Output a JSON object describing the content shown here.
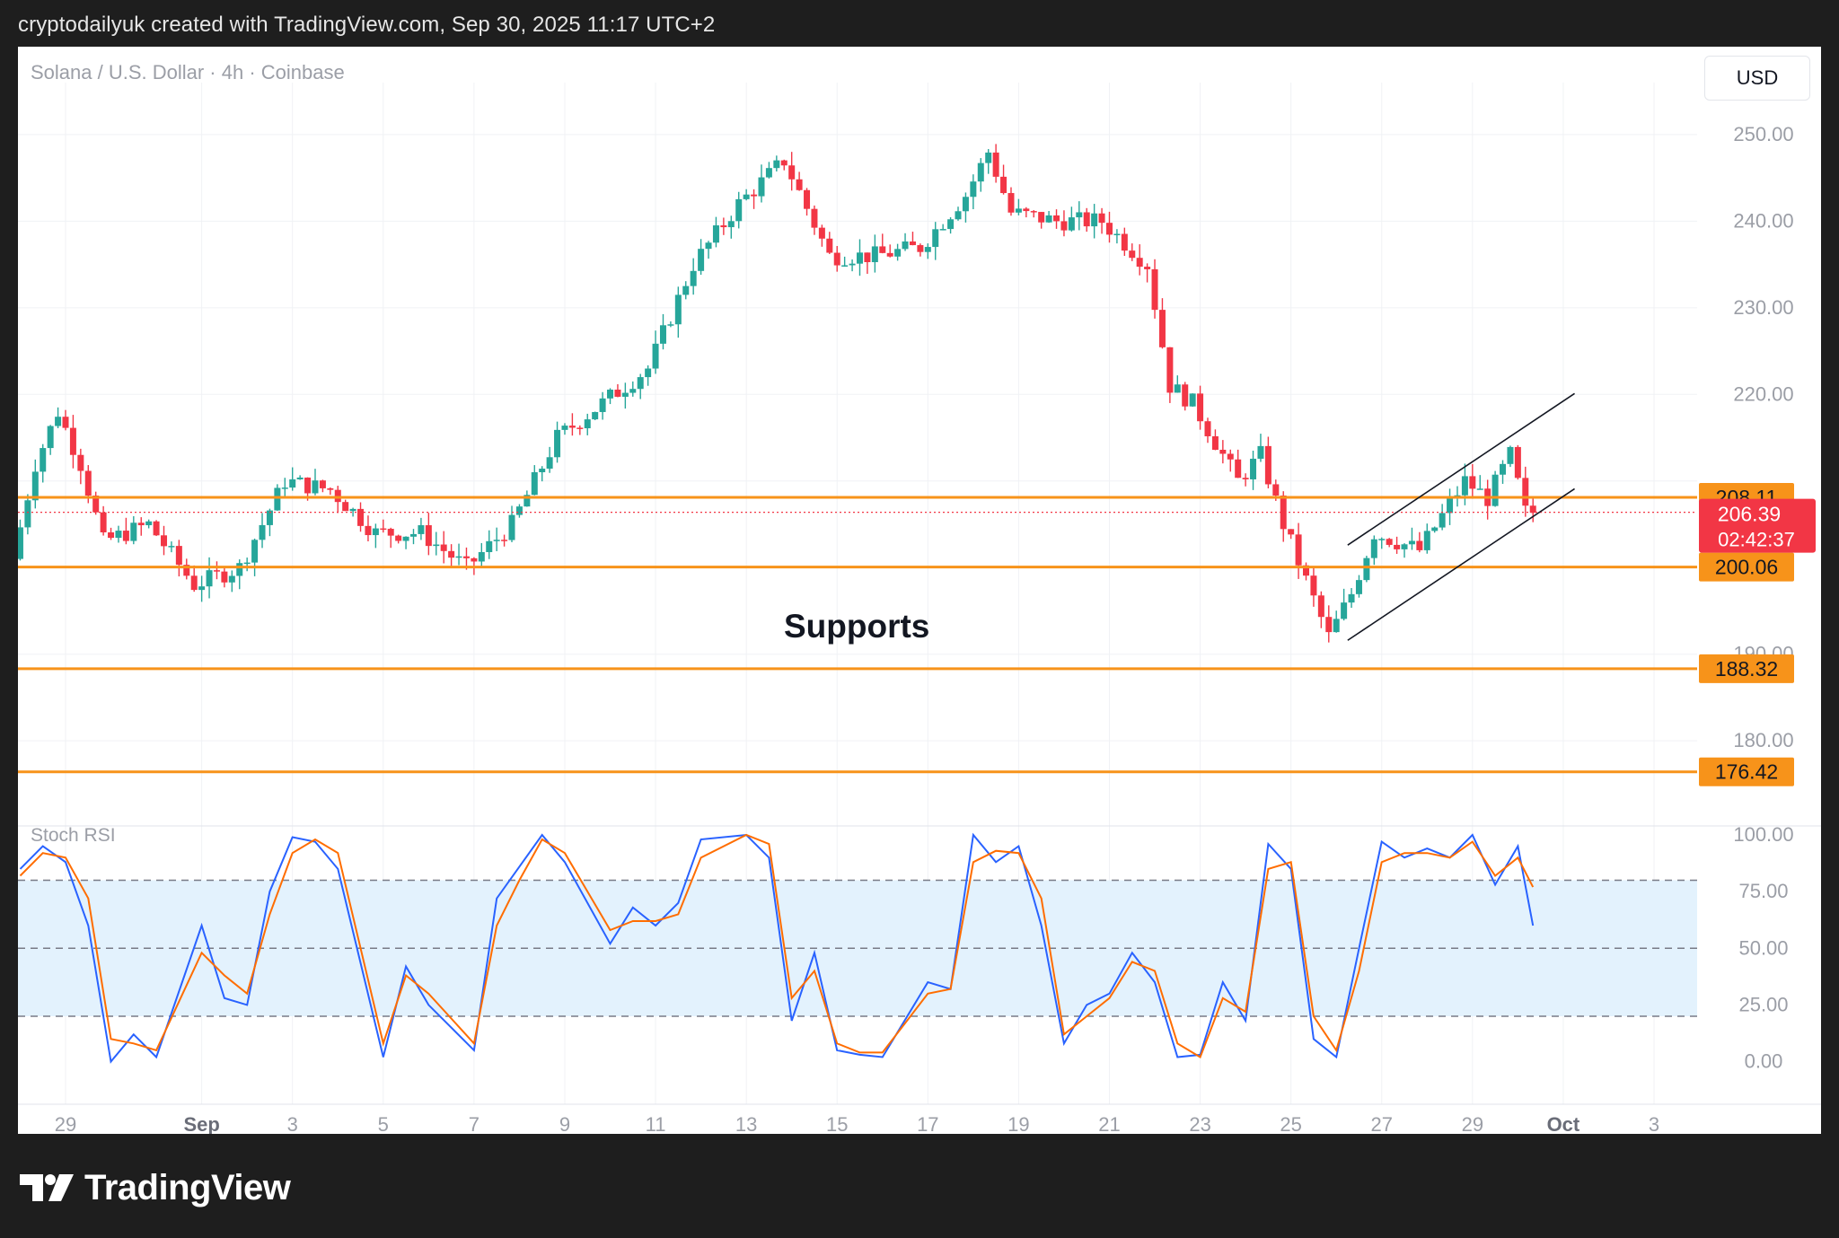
{
  "header": {
    "credit": "cryptodailyuk created with TradingView.com, Sep 30, 2025 11:17 UTC+2"
  },
  "footer": {
    "brand": "TradingView"
  },
  "chart_header": {
    "title": "Solana / U.S. Dollar · 4h · Coinbase",
    "currency_button": "USD"
  },
  "colors": {
    "bull": "#26a69a",
    "bear": "#f23645",
    "support_line": "#f7931a",
    "channel": "#131722",
    "stoch_k": "#2962ff",
    "stoch_d": "#ff6d00",
    "stoch_band": "#e3f2fd"
  },
  "chart_data": [
    {
      "type": "line",
      "title": "Solana / U.S. Dollar · 4h · Coinbase",
      "x_ticks": [
        "29",
        "Sep",
        "3",
        "5",
        "7",
        "9",
        "11",
        "13",
        "15",
        "17",
        "19",
        "21",
        "23",
        "25",
        "27",
        "29",
        "Oct",
        "3"
      ],
      "y_ticks": [
        "250.00",
        "240.00",
        "230.00",
        "220.00",
        "190.00",
        "180.00"
      ],
      "ylim": [
        171,
        256
      ],
      "grid": true,
      "price_path": [
        {
          "x": "Aug 28",
          "y": 201
        },
        {
          "x": "Aug 28 12:00",
          "y": 212
        },
        {
          "x": "Aug 29",
          "y": 218
        },
        {
          "x": "Aug 29 12:00",
          "y": 212
        },
        {
          "x": "Aug 30",
          "y": 203
        },
        {
          "x": "Aug 31",
          "y": 205
        },
        {
          "x": "Sep 1",
          "y": 198
        },
        {
          "x": "Sep 2",
          "y": 200
        },
        {
          "x": "Sep 3",
          "y": 210
        },
        {
          "x": "Sep 4",
          "y": 209
        },
        {
          "x": "Sep 5",
          "y": 204
        },
        {
          "x": "Sep 6",
          "y": 204
        },
        {
          "x": "Sep 7",
          "y": 200
        },
        {
          "x": "Sep 8",
          "y": 205
        },
        {
          "x": "Sep 9",
          "y": 215
        },
        {
          "x": "Sep 10",
          "y": 219
        },
        {
          "x": "Sep 11",
          "y": 223
        },
        {
          "x": "Sep 12",
          "y": 235
        },
        {
          "x": "Sep 13",
          "y": 242
        },
        {
          "x": "Sep 14",
          "y": 247
        },
        {
          "x": "Sep 15",
          "y": 236
        },
        {
          "x": "Sep 16",
          "y": 236
        },
        {
          "x": "Sep 17",
          "y": 237
        },
        {
          "x": "Sep 18",
          "y": 243
        },
        {
          "x": "Sep 18 12:00",
          "y": 248
        },
        {
          "x": "Sep 19",
          "y": 241
        },
        {
          "x": "Sep 20",
          "y": 240
        },
        {
          "x": "Sep 21",
          "y": 240
        },
        {
          "x": "Sep 22",
          "y": 235
        },
        {
          "x": "Sep 22 12:00",
          "y": 221
        },
        {
          "x": "Sep 23",
          "y": 219
        },
        {
          "x": "Sep 24",
          "y": 210
        },
        {
          "x": "Sep 24 12:00",
          "y": 213
        },
        {
          "x": "Sep 25",
          "y": 205
        },
        {
          "x": "Sep 26",
          "y": 192
        },
        {
          "x": "Sep 26 12:00",
          "y": 197
        },
        {
          "x": "Sep 27",
          "y": 204
        },
        {
          "x": "Sep 28",
          "y": 202
        },
        {
          "x": "Sep 29",
          "y": 210
        },
        {
          "x": "Sep 29 12:00",
          "y": 208
        },
        {
          "x": "Sep 30",
          "y": 213
        },
        {
          "x": "Sep 30 08:00",
          "y": 206.39
        }
      ],
      "support_levels": [
        "208.11",
        "200.06",
        "188.32",
        "176.42"
      ],
      "current_price": "206.39",
      "countdown": "02:42:37",
      "annotation": "Supports",
      "ascending_channel": {
        "upper": [
          {
            "x": "Sep 26 06:00",
            "y": 202.6
          },
          {
            "x": "Oct 1 06:00",
            "y": 220.1
          }
        ],
        "lower": [
          {
            "x": "Sep 26 06:00",
            "y": 191.6
          },
          {
            "x": "Oct 1 06:00",
            "y": 209.1
          }
        ]
      }
    },
    {
      "type": "line",
      "title": "Stoch RSI",
      "y_ticks": [
        "100.00",
        "75.00",
        "50.00",
        "25.00",
        "0.00"
      ],
      "ylim": [
        0,
        100
      ],
      "band": [
        20,
        80
      ],
      "series": [
        {
          "color": "#2962ff",
          "points": [
            {
              "x": "Aug 28",
              "y": 85
            },
            {
              "x": "Aug 28 12:00",
              "y": 95
            },
            {
              "x": "Aug 29",
              "y": 88
            },
            {
              "x": "Aug 29 12:00",
              "y": 60
            },
            {
              "x": "Aug 30",
              "y": 0
            },
            {
              "x": "Aug 30 12:00",
              "y": 12
            },
            {
              "x": "Aug 31",
              "y": 2
            },
            {
              "x": "Sep 1",
              "y": 60
            },
            {
              "x": "Sep 1 12:00",
              "y": 28
            },
            {
              "x": "Sep 2",
              "y": 25
            },
            {
              "x": "Sep 2 12:00",
              "y": 75
            },
            {
              "x": "Sep 3",
              "y": 99
            },
            {
              "x": "Sep 3 12:00",
              "y": 97
            },
            {
              "x": "Sep 4",
              "y": 85
            },
            {
              "x": "Sep 5",
              "y": 2
            },
            {
              "x": "Sep 5 12:00",
              "y": 42
            },
            {
              "x": "Sep 6",
              "y": 25
            },
            {
              "x": "Sep 7",
              "y": 5
            },
            {
              "x": "Sep 7 12:00",
              "y": 72
            },
            {
              "x": "Sep 8",
              "y": 86
            },
            {
              "x": "Sep 8 12:00",
              "y": 100
            },
            {
              "x": "Sep 9",
              "y": 88
            },
            {
              "x": "Sep 10",
              "y": 52
            },
            {
              "x": "Sep 10 12:00",
              "y": 68
            },
            {
              "x": "Sep 11",
              "y": 60
            },
            {
              "x": "Sep 11 12:00",
              "y": 70
            },
            {
              "x": "Sep 12",
              "y": 98
            },
            {
              "x": "Sep 13",
              "y": 100
            },
            {
              "x": "Sep 13 12:00",
              "y": 90
            },
            {
              "x": "Sep 14",
              "y": 18
            },
            {
              "x": "Sep 14 12:00",
              "y": 48
            },
            {
              "x": "Sep 15",
              "y": 5
            },
            {
              "x": "Sep 15 12:00",
              "y": 3
            },
            {
              "x": "Sep 16",
              "y": 2
            },
            {
              "x": "Sep 17",
              "y": 35
            },
            {
              "x": "Sep 17 12:00",
              "y": 32
            },
            {
              "x": "Sep 18",
              "y": 100
            },
            {
              "x": "Sep 18 12:00",
              "y": 88
            },
            {
              "x": "Sep 19",
              "y": 95
            },
            {
              "x": "Sep 19 12:00",
              "y": 60
            },
            {
              "x": "Sep 20",
              "y": 8
            },
            {
              "x": "Sep 20 12:00",
              "y": 25
            },
            {
              "x": "Sep 21",
              "y": 30
            },
            {
              "x": "Sep 21 12:00",
              "y": 48
            },
            {
              "x": "Sep 22",
              "y": 35
            },
            {
              "x": "Sep 22 12:00",
              "y": 2
            },
            {
              "x": "Sep 23",
              "y": 3
            },
            {
              "x": "Sep 23 12:00",
              "y": 35
            },
            {
              "x": "Sep 24",
              "y": 18
            },
            {
              "x": "Sep 24 12:00",
              "y": 96
            },
            {
              "x": "Sep 25",
              "y": 85
            },
            {
              "x": "Sep 25 12:00",
              "y": 10
            },
            {
              "x": "Sep 26",
              "y": 2
            },
            {
              "x": "Sep 26 12:00",
              "y": 50
            },
            {
              "x": "Sep 27",
              "y": 97
            },
            {
              "x": "Sep 27 12:00",
              "y": 90
            },
            {
              "x": "Sep 28",
              "y": 94
            },
            {
              "x": "Sep 28 12:00",
              "y": 90
            },
            {
              "x": "Sep 29",
              "y": 100
            },
            {
              "x": "Sep 29 12:00",
              "y": 78
            },
            {
              "x": "Sep 30",
              "y": 95
            },
            {
              "x": "Sep 30 08:00",
              "y": 60
            }
          ]
        },
        {
          "color": "#ff6d00",
          "points": [
            {
              "x": "Aug 28",
              "y": 82
            },
            {
              "x": "Aug 28 12:00",
              "y": 92
            },
            {
              "x": "Aug 29",
              "y": 90
            },
            {
              "x": "Aug 29 12:00",
              "y": 72
            },
            {
              "x": "Aug 30",
              "y": 10
            },
            {
              "x": "Aug 30 12:00",
              "y": 8
            },
            {
              "x": "Aug 31",
              "y": 5
            },
            {
              "x": "Sep 1",
              "y": 48
            },
            {
              "x": "Sep 1 12:00",
              "y": 38
            },
            {
              "x": "Sep 2",
              "y": 30
            },
            {
              "x": "Sep 2 12:00",
              "y": 65
            },
            {
              "x": "Sep 3",
              "y": 92
            },
            {
              "x": "Sep 3 12:00",
              "y": 98
            },
            {
              "x": "Sep 4",
              "y": 92
            },
            {
              "x": "Sep 5",
              "y": 8
            },
            {
              "x": "Sep 5 12:00",
              "y": 38
            },
            {
              "x": "Sep 6",
              "y": 30
            },
            {
              "x": "Sep 7",
              "y": 8
            },
            {
              "x": "Sep 7 12:00",
              "y": 60
            },
            {
              "x": "Sep 8",
              "y": 80
            },
            {
              "x": "Sep 8 12:00",
              "y": 98
            },
            {
              "x": "Sep 9",
              "y": 92
            },
            {
              "x": "Sep 10",
              "y": 58
            },
            {
              "x": "Sep 10 12:00",
              "y": 62
            },
            {
              "x": "Sep 11",
              "y": 62
            },
            {
              "x": "Sep 11 12:00",
              "y": 65
            },
            {
              "x": "Sep 12",
              "y": 90
            },
            {
              "x": "Sep 13",
              "y": 100
            },
            {
              "x": "Sep 13 12:00",
              "y": 96
            },
            {
              "x": "Sep 14",
              "y": 28
            },
            {
              "x": "Sep 14 12:00",
              "y": 40
            },
            {
              "x": "Sep 15",
              "y": 8
            },
            {
              "x": "Sep 15 12:00",
              "y": 4
            },
            {
              "x": "Sep 16",
              "y": 4
            },
            {
              "x": "Sep 17",
              "y": 30
            },
            {
              "x": "Sep 17 12:00",
              "y": 32
            },
            {
              "x": "Sep 18",
              "y": 88
            },
            {
              "x": "Sep 18 12:00",
              "y": 93
            },
            {
              "x": "Sep 19",
              "y": 92
            },
            {
              "x": "Sep 19 12:00",
              "y": 72
            },
            {
              "x": "Sep 20",
              "y": 12
            },
            {
              "x": "Sep 20 12:00",
              "y": 20
            },
            {
              "x": "Sep 21",
              "y": 28
            },
            {
              "x": "Sep 21 12:00",
              "y": 44
            },
            {
              "x": "Sep 22",
              "y": 40
            },
            {
              "x": "Sep 22 12:00",
              "y": 8
            },
            {
              "x": "Sep 23",
              "y": 2
            },
            {
              "x": "Sep 23 12:00",
              "y": 28
            },
            {
              "x": "Sep 24",
              "y": 22
            },
            {
              "x": "Sep 24 12:00",
              "y": 85
            },
            {
              "x": "Sep 25",
              "y": 88
            },
            {
              "x": "Sep 25 12:00",
              "y": 20
            },
            {
              "x": "Sep 26",
              "y": 5
            },
            {
              "x": "Sep 26 12:00",
              "y": 40
            },
            {
              "x": "Sep 27",
              "y": 88
            },
            {
              "x": "Sep 27 12:00",
              "y": 92
            },
            {
              "x": "Sep 28",
              "y": 92
            },
            {
              "x": "Sep 28 12:00",
              "y": 90
            },
            {
              "x": "Sep 29",
              "y": 97
            },
            {
              "x": "Sep 29 12:00",
              "y": 82
            },
            {
              "x": "Sep 30",
              "y": 90
            },
            {
              "x": "Sep 30 08:00",
              "y": 77
            }
          ]
        }
      ]
    }
  ]
}
